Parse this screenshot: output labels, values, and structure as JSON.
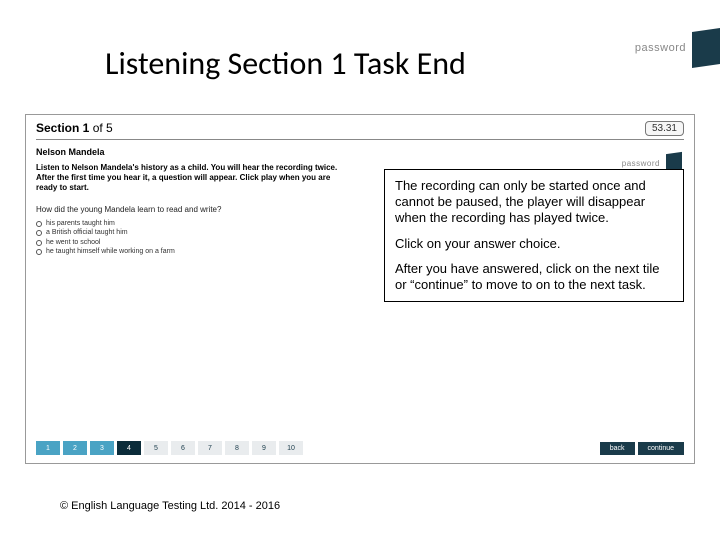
{
  "slide": {
    "title": "Listening Section 1 Task End",
    "copyright": "© English Language Testing Ltd. 2014 - 2016"
  },
  "logo": {
    "text": "password"
  },
  "panel": {
    "section_label_bold": "Section 1",
    "section_label_rest": " of 5",
    "timer": "53.31",
    "subtitle": "Nelson Mandela",
    "instr1": "Listen to Nelson Mandela's history as a child. You will hear the recording twice.",
    "instr2": "After the first time you hear it, a question will appear. Click play when you are ready to start.",
    "question": "How did the young Mandela learn to read and write?",
    "choices": [
      "his parents taught him",
      "a British official taught him",
      "he went to school",
      "he taught himself while working on a farm"
    ],
    "tiles": [
      "1",
      "2",
      "3",
      "4",
      "5",
      "6",
      "7",
      "8",
      "9",
      "10"
    ],
    "back": "back",
    "continue": "continue"
  },
  "callout": {
    "p1": "The recording can only be started once and cannot be paused, the player will disappear when the recording has played twice.",
    "p2": "Click on your answer choice.",
    "p3": "After you have answered, click on the next tile or “continue” to move to on to the next task."
  }
}
